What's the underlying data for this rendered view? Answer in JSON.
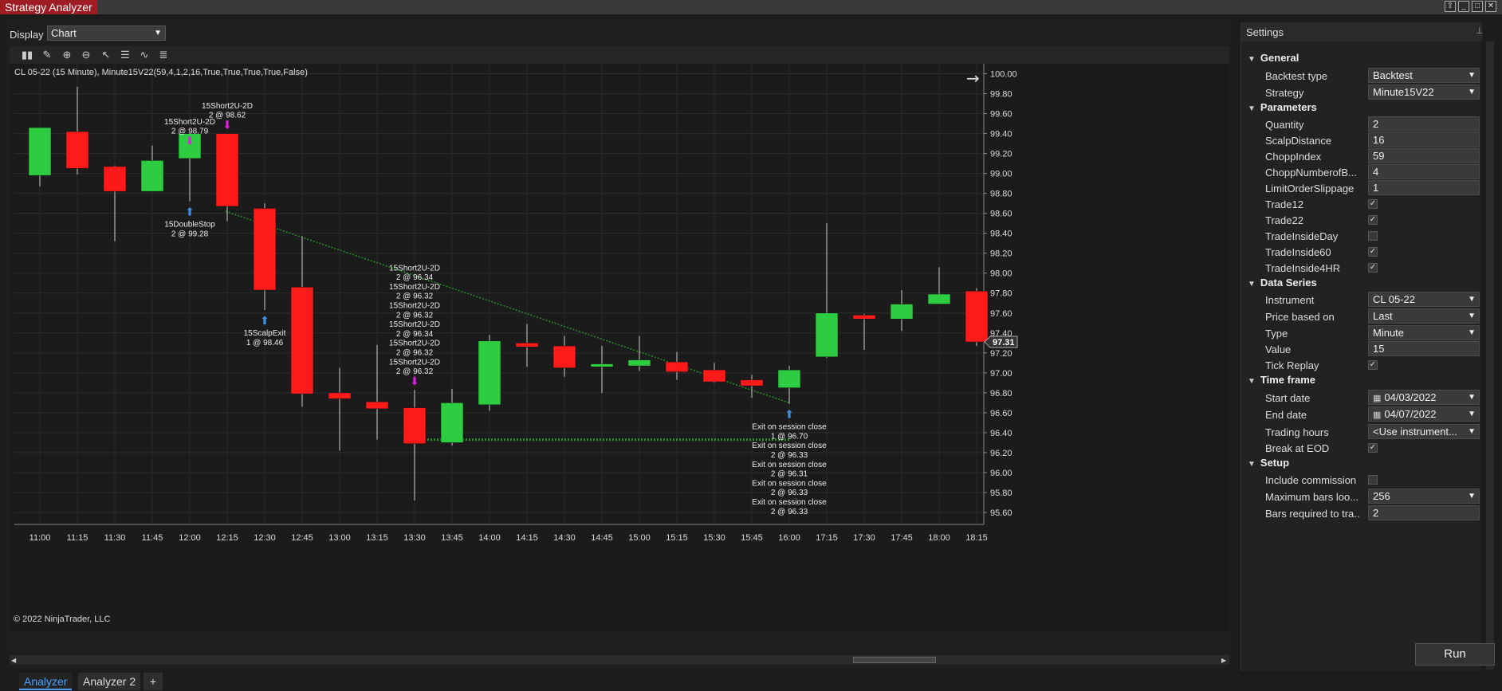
{
  "window": {
    "title": "Strategy Analyzer"
  },
  "display": {
    "label": "Display",
    "value": "Chart"
  },
  "chart": {
    "title": "CL 05-22 (15 Minute), Minute15V22(59,4,1,2,16,True,True,True,True,False)",
    "copyright": "© 2022 NinjaTrader, LLC",
    "last_price": "97.31"
  },
  "chart_data": {
    "type": "candlestick",
    "x_labels": [
      "11:00",
      "11:15",
      "11:30",
      "11:45",
      "12:00",
      "12:15",
      "12:30",
      "12:45",
      "13:00",
      "13:15",
      "13:30",
      "13:45",
      "14:00",
      "14:15",
      "14:30",
      "14:45",
      "15:00",
      "15:15",
      "15:30",
      "15:45",
      "16:00",
      "17:15",
      "17:30",
      "17:45",
      "18:00",
      "18:15"
    ],
    "y_ticks": [
      "100.00",
      "99.80",
      "99.60",
      "99.40",
      "99.20",
      "99.00",
      "98.80",
      "98.60",
      "98.40",
      "98.20",
      "98.00",
      "97.80",
      "97.60",
      "97.40",
      "97.20",
      "97.00",
      "96.80",
      "96.60",
      "96.40",
      "96.20",
      "96.00",
      "95.80",
      "95.60"
    ],
    "ylim": [
      95.48,
      100.1
    ],
    "candles": [
      {
        "o": 98.98,
        "h": 99.45,
        "l": 98.87,
        "c": 99.46
      },
      {
        "o": 99.42,
        "h": 99.87,
        "l": 98.99,
        "c": 99.05
      },
      {
        "o": 99.07,
        "h": 99.08,
        "l": 98.32,
        "c": 98.82
      },
      {
        "o": 98.82,
        "h": 99.28,
        "l": 98.82,
        "c": 99.13
      },
      {
        "o": 99.15,
        "h": 99.24,
        "l": 98.72,
        "c": 99.4
      },
      {
        "o": 99.4,
        "h": 99.4,
        "l": 98.52,
        "c": 98.67
      },
      {
        "o": 98.65,
        "h": 98.7,
        "l": 97.63,
        "c": 97.83
      },
      {
        "o": 97.86,
        "h": 98.37,
        "l": 96.66,
        "c": 96.79
      },
      {
        "o": 96.8,
        "h": 97.05,
        "l": 96.22,
        "c": 96.74
      },
      {
        "o": 96.71,
        "h": 97.28,
        "l": 96.33,
        "c": 96.64
      },
      {
        "o": 96.65,
        "h": 96.83,
        "l": 95.72,
        "c": 96.29
      },
      {
        "o": 96.3,
        "h": 96.84,
        "l": 96.27,
        "c": 96.7
      },
      {
        "o": 96.68,
        "h": 97.38,
        "l": 96.62,
        "c": 97.32
      },
      {
        "o": 97.3,
        "h": 97.49,
        "l": 97.06,
        "c": 97.26
      },
      {
        "o": 97.27,
        "h": 97.37,
        "l": 96.96,
        "c": 97.05
      },
      {
        "o": 97.06,
        "h": 97.27,
        "l": 96.8,
        "c": 97.09
      },
      {
        "o": 97.07,
        "h": 97.37,
        "l": 97.02,
        "c": 97.13
      },
      {
        "o": 97.11,
        "h": 97.21,
        "l": 96.93,
        "c": 97.01
      },
      {
        "o": 97.03,
        "h": 97.1,
        "l": 96.9,
        "c": 96.91
      },
      {
        "o": 96.93,
        "h": 96.98,
        "l": 96.75,
        "c": 96.87
      },
      {
        "o": 96.85,
        "h": 97.07,
        "l": 96.69,
        "c": 97.03
      },
      {
        "o": 97.16,
        "h": 98.5,
        "l": 97.15,
        "c": 97.6
      },
      {
        "o": 97.58,
        "h": 97.59,
        "l": 97.23,
        "c": 97.54
      },
      {
        "o": 97.54,
        "h": 97.83,
        "l": 97.42,
        "c": 97.69
      },
      {
        "o": 97.69,
        "h": 98.06,
        "l": 97.69,
        "c": 97.79
      },
      {
        "o": 97.82,
        "h": 97.85,
        "l": 97.27,
        "c": 97.31
      }
    ],
    "annotations": [
      {
        "text": [
          "15Short2U-2D",
          "2 @ 98.79"
        ],
        "bar": 4,
        "pos": "above"
      },
      {
        "text": [
          "15Short2U-2D",
          "2 @ 98.62"
        ],
        "bar": 5,
        "pos": "above"
      },
      {
        "text": [
          "15DoubleStop",
          "2 @ 99.28"
        ],
        "bar": 4,
        "pos": "below"
      },
      {
        "text": [
          "15ScalpExit",
          "1 @ 98.46"
        ],
        "bar": 6,
        "pos": "below"
      },
      {
        "text": [
          "15Short2U-2D",
          "2 @ 96.34",
          "15Short2U-2D",
          "2 @ 96.32",
          "15Short2U-2D",
          "2 @ 96.32",
          "15Short2U-2D",
          "2 @ 96.34",
          "15Short2U-2D",
          "2 @ 96.32",
          "15Short2U-2D",
          "2 @ 96.32"
        ],
        "bar": 10,
        "pos": "above"
      },
      {
        "text": [
          "Exit on session close",
          "1 @ 96.70",
          "Exit on session close",
          "2 @ 96.33",
          "Exit on session close",
          "2 @ 96.31",
          "Exit on session close",
          "2 @ 96.33",
          "Exit on session close",
          "2 @ 96.33",
          "Exit on session close",
          "2 @ 96.33",
          "Exit on session close"
        ],
        "bar": 20,
        "pos": "below"
      }
    ]
  },
  "tabs": [
    {
      "label": "Analyzer"
    },
    {
      "label": "Analyzer 2"
    },
    {
      "label": "+"
    }
  ],
  "settings": {
    "title": "Settings",
    "sections": {
      "general": "General",
      "parameters": "Parameters",
      "data_series": "Data Series",
      "time_frame": "Time frame",
      "setup": "Setup"
    },
    "backtest_type": {
      "label": "Backtest type",
      "value": "Backtest"
    },
    "strategy": {
      "label": "Strategy",
      "value": "Minute15V22"
    },
    "quantity": {
      "label": "Quantity",
      "value": "2"
    },
    "scalp_distance": {
      "label": "ScalpDistance",
      "value": "16"
    },
    "chopp_index": {
      "label": "ChoppIndex",
      "value": "59"
    },
    "chopp_number": {
      "label": "ChoppNumberofB...",
      "value": "4"
    },
    "limit_slippage": {
      "label": "LimitOrderSlippage",
      "value": "1"
    },
    "trade12": {
      "label": "Trade12",
      "value": "✓"
    },
    "trade22": {
      "label": "Trade22",
      "value": "✓"
    },
    "trade_inside_day": {
      "label": "TradeInsideDay",
      "value": ""
    },
    "trade_inside60": {
      "label": "TradeInside60",
      "value": "✓"
    },
    "trade_inside4hr": {
      "label": "TradeInside4HR",
      "value": "✓"
    },
    "instrument": {
      "label": "Instrument",
      "value": "CL 05-22"
    },
    "price_based_on": {
      "label": "Price based on",
      "value": "Last"
    },
    "type": {
      "label": "Type",
      "value": "Minute"
    },
    "value": {
      "label": "Value",
      "value": "15"
    },
    "tick_replay": {
      "label": "Tick Replay",
      "value": "✓"
    },
    "start_date": {
      "label": "Start date",
      "value": "04/03/2022"
    },
    "end_date": {
      "label": "End date",
      "value": "04/07/2022"
    },
    "trading_hours": {
      "label": "Trading hours",
      "value": "<Use instrument..."
    },
    "break_at_eod": {
      "label": "Break at EOD",
      "value": "✓"
    },
    "include_commission": {
      "label": "Include commission",
      "value": ""
    },
    "max_bars": {
      "label": "Maximum bars loo...",
      "value": "256"
    },
    "bars_required": {
      "label": "Bars required to tra...",
      "value": "2"
    },
    "template": "template",
    "run": "Run"
  },
  "colors": {
    "up": "#2ecc40",
    "down": "#ff1a1a",
    "accent": "#4aa0ff",
    "title_bg": "#a01c24"
  }
}
